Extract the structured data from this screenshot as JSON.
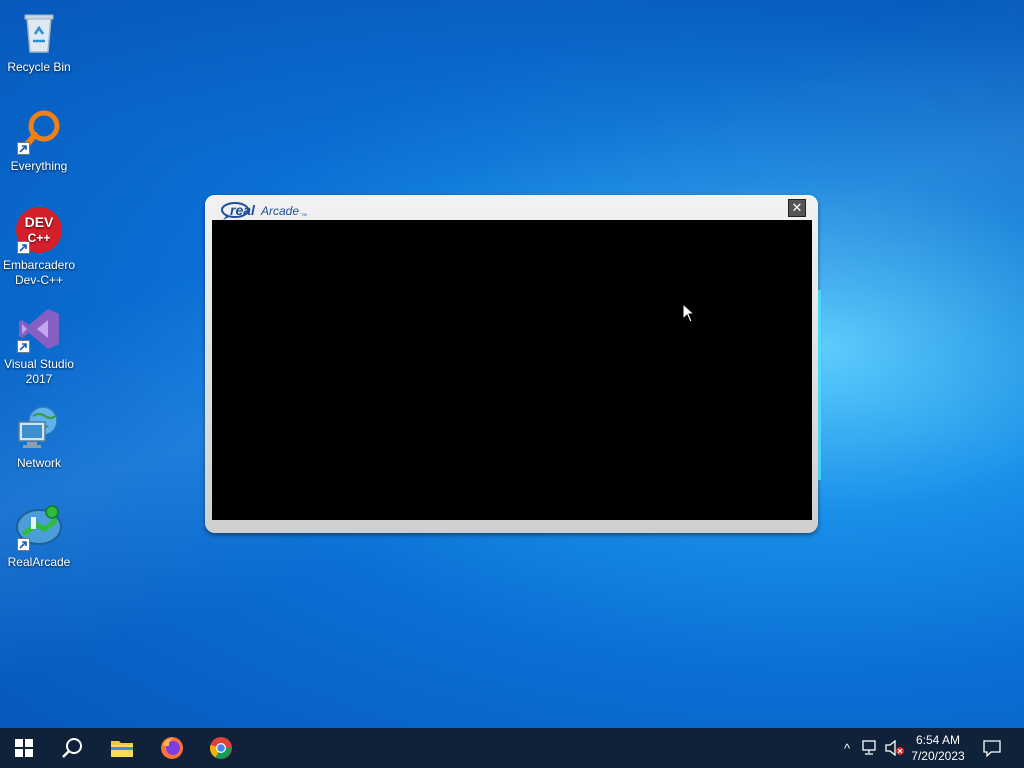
{
  "desktop": {
    "icons": [
      {
        "label": "Recycle Bin",
        "icon": "recycle-bin-icon"
      },
      {
        "label": "Everything",
        "icon": "everything-search-icon"
      },
      {
        "label": "Embarcadero Dev-C++",
        "icon": "devcpp-icon",
        "glyph_text": "DEV C++"
      },
      {
        "label": "Visual Studio 2017",
        "icon": "visual-studio-icon"
      },
      {
        "label": "Network",
        "icon": "network-icon"
      },
      {
        "label": "RealArcade",
        "icon": "realarcade-icon"
      }
    ]
  },
  "window": {
    "logo_real": "real",
    "logo_arcade": "Arcade",
    "logo_tm": "TM",
    "close_label": "✕"
  },
  "taskbar": {
    "start": "windows-start-icon",
    "search": "search-icon",
    "apps": [
      "file-explorer-icon",
      "firefox-icon",
      "chrome-icon"
    ],
    "tray": {
      "chevron": "^",
      "network": "network-tray-icon",
      "volume": "volume-muted-icon"
    },
    "clock": {
      "time": "6:54 AM",
      "date": "7/20/2023"
    },
    "notification": "action-center-icon"
  },
  "colors": {
    "taskbar": "#10223a",
    "accent": "#0a6fd4",
    "window_content": "#000000"
  }
}
